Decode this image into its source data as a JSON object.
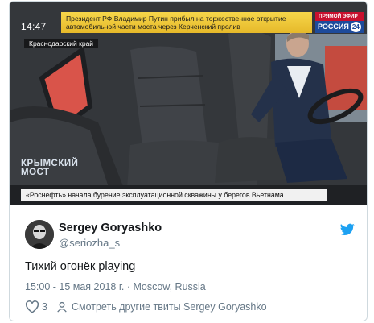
{
  "video": {
    "clock": "14:47",
    "headline": "Президент РФ Владимир Путин прибыл на торжественное открытие автомобильной части моста через Керченский пролив",
    "channel_top": "ПРЯМОЙ ЭФИР",
    "channel_name": "РОССИЯ",
    "channel_number": "24",
    "region": "Краснодарский край",
    "show_logo_line1": "КРЫМСКИЙ",
    "show_logo_line2": "МОСТ",
    "ticker": "«Роснефть» начала бурение эксплуатационной скважины у берегов Вьетнама"
  },
  "author": {
    "name": "Sergey Goryashko",
    "handle": "@seriozha_s"
  },
  "tweet": {
    "text": "Тихий огонёк playing",
    "meta": "15:00 - 15 мая 2018 г. · Moscow, Russia"
  },
  "actions": {
    "like_count": "3",
    "more_label": "Смотреть другие твиты Sergey Goryashko"
  },
  "colors": {
    "twitter_blue": "#1da1f2",
    "text_gray": "#657786",
    "banner_yellow": "#f2cd3f",
    "channel_red": "#c8102e",
    "channel_blue": "#1d4b9b"
  }
}
